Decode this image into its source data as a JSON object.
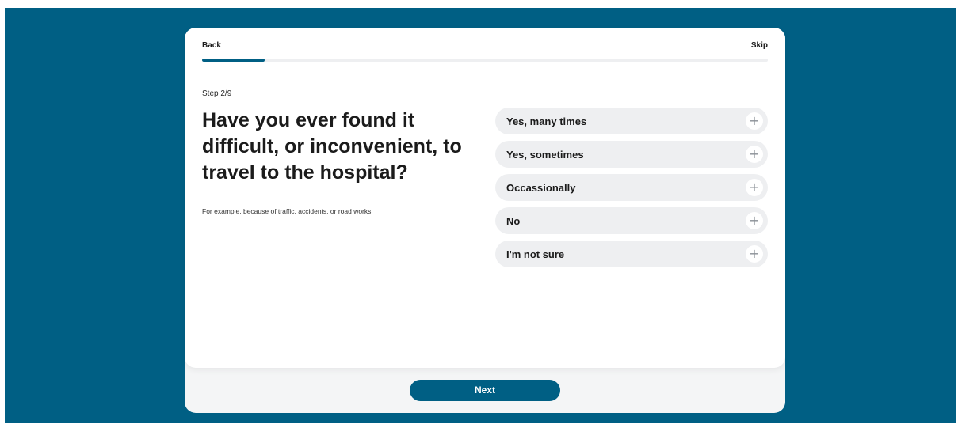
{
  "nav": {
    "back_label": "Back",
    "skip_label": "Skip"
  },
  "progress": {
    "current_step": 2,
    "total_steps": 9,
    "fraction": 0.111
  },
  "step_label": "Step 2/9",
  "question": "Have you ever found it difficult, or inconvenient, to travel to the hospital?",
  "hint": "For example, because of traffic, accidents, or road works.",
  "options": [
    {
      "label": "Yes, many times",
      "icon": "plus-icon"
    },
    {
      "label": "Yes, sometimes",
      "icon": "plus-icon"
    },
    {
      "label": "Occassionally",
      "icon": "plus-icon"
    },
    {
      "label": "No",
      "icon": "plus-icon"
    },
    {
      "label": "I'm not sure",
      "icon": "plus-icon"
    }
  ],
  "next_label": "Next",
  "colors": {
    "brand": "#005f84",
    "option_bg": "#eeeff1",
    "text": "#1b1b1b"
  }
}
